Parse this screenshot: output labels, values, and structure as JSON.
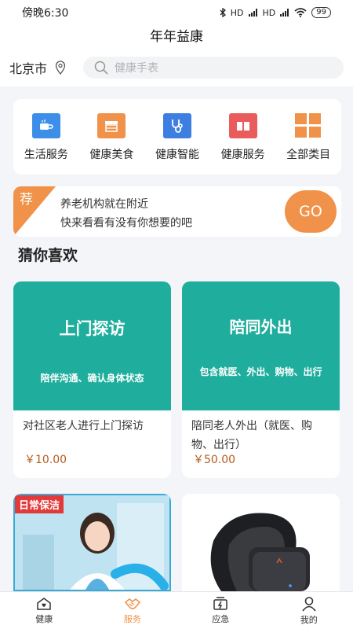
{
  "status_bar": {
    "time": "傍晚6:30",
    "signal_1": "HD",
    "signal_2": "HD",
    "battery": "99"
  },
  "app_title": "年年益康",
  "location": {
    "city": "北京市"
  },
  "search": {
    "placeholder": "健康手表"
  },
  "categories": [
    {
      "label": "生活服务",
      "icon": "coffee-cup-icon",
      "color": "#3d8ee8"
    },
    {
      "label": "健康美食",
      "icon": "food-tray-icon",
      "color": "#f0924a"
    },
    {
      "label": "健康智能",
      "icon": "stethoscope-icon",
      "color": "#3d7fe0"
    },
    {
      "label": "健康服务",
      "icon": "book-icon",
      "color": "#ea5b5b"
    },
    {
      "label": "全部类目",
      "icon": "grid-icon",
      "color": "#f0924a"
    }
  ],
  "banner": {
    "tag": "荐",
    "line1": "养老机构就在附近",
    "line2": "快来看看有没有你想要的吧",
    "button": "GO"
  },
  "section_title": "猜你喜欢",
  "products": [
    {
      "image_title": "上门探访",
      "image_subtitle": "陪伴沟通、确认身体状态",
      "description": "对社区老人进行上门探访",
      "price": "￥10.00"
    },
    {
      "image_title": "陪同外出",
      "image_subtitle": "包含就医、外出、购物、出行",
      "description": "陪同老人外出（就医、购物、出行）",
      "price": "￥50.00"
    },
    {
      "image_tag": "日常保洁"
    },
    {}
  ],
  "tabs": [
    {
      "label": "健康",
      "active": false
    },
    {
      "label": "服务",
      "active": true
    },
    {
      "label": "应急",
      "active": false
    },
    {
      "label": "我的",
      "active": false
    }
  ],
  "colors": {
    "accent": "#f0924a",
    "teal": "#1fae9d",
    "price": "#b45c1c"
  }
}
